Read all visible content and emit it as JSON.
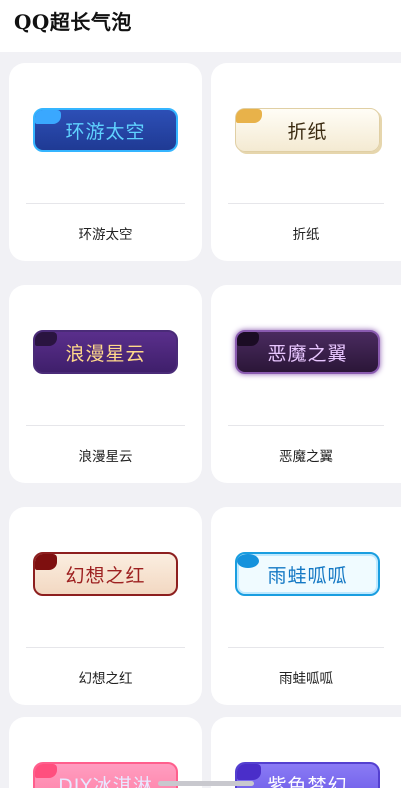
{
  "header": {
    "title": "QQ超长气泡"
  },
  "cards": [
    {
      "bubble_text": "环游太空",
      "caption": "环游太空"
    },
    {
      "bubble_text": "折纸",
      "caption": "折纸"
    },
    {
      "bubble_text": "浪漫星云",
      "caption": "浪漫星云"
    },
    {
      "bubble_text": "恶魔之翼",
      "caption": "恶魔之翼"
    },
    {
      "bubble_text": "幻想之红",
      "caption": "幻想之红"
    },
    {
      "bubble_text": "雨蛙呱呱",
      "caption": "雨蛙呱呱"
    },
    {
      "bubble_text": "DIY冰淇淋"
    },
    {
      "bubble_text": "紫色梦幻"
    }
  ],
  "colors": {
    "page_background": "#f1f1f5",
    "card_background": "#ffffff"
  }
}
